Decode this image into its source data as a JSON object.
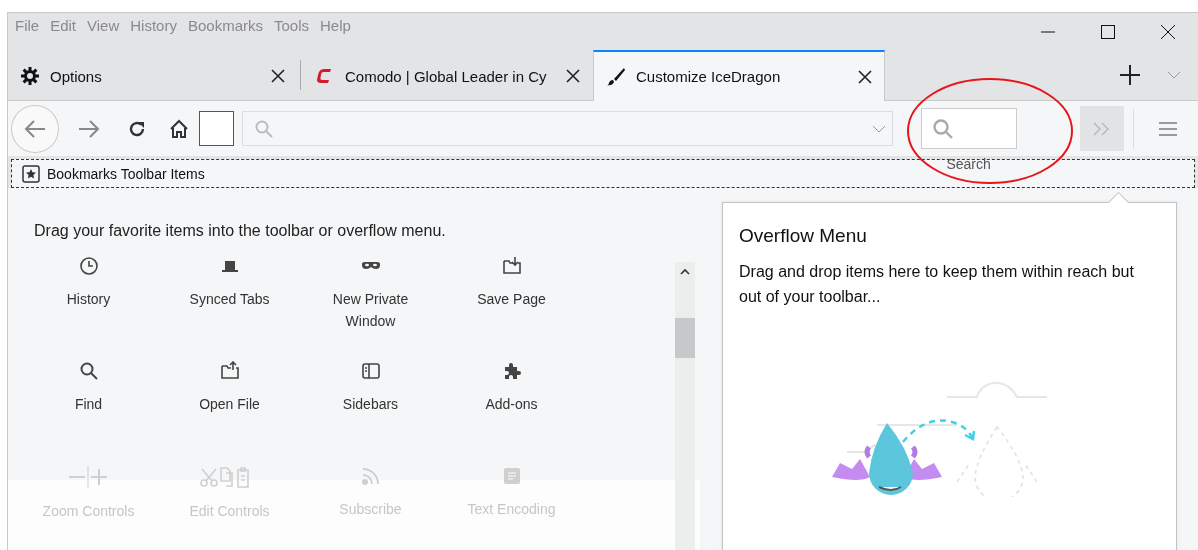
{
  "menu_bar": [
    "File",
    "Edit",
    "View",
    "History",
    "Bookmarks",
    "Tools",
    "Help"
  ],
  "tabs": [
    {
      "label": "Options",
      "selected": false
    },
    {
      "label": "Comodo | Global Leader in Cy",
      "selected": false
    },
    {
      "label": "Customize IceDragon",
      "selected": true
    }
  ],
  "nav_bar": {
    "search_label": "Search"
  },
  "bookmarks_toolbar": {
    "label": "Bookmarks Toolbar Items"
  },
  "palette": {
    "instruction": "Drag your favorite items into the toolbar or overflow menu.",
    "items": [
      {
        "label": "History",
        "disabled": false
      },
      {
        "label": "Synced Tabs",
        "disabled": false
      },
      {
        "label": "New Private Window",
        "disabled": false
      },
      {
        "label": "Save Page",
        "disabled": false
      },
      {
        "label": "Find",
        "disabled": false
      },
      {
        "label": "Open File",
        "disabled": false
      },
      {
        "label": "Sidebars",
        "disabled": false
      },
      {
        "label": "Add-ons",
        "disabled": false
      },
      {
        "label": "Zoom Controls",
        "disabled": true
      },
      {
        "label": "Edit Controls",
        "disabled": true
      },
      {
        "label": "Subscribe",
        "disabled": true
      },
      {
        "label": "Text Encoding",
        "disabled": true
      }
    ]
  },
  "overflow_menu": {
    "title": "Overflow Menu",
    "description": "Drag and drop items here to keep them within reach but out of your toolbar..."
  }
}
